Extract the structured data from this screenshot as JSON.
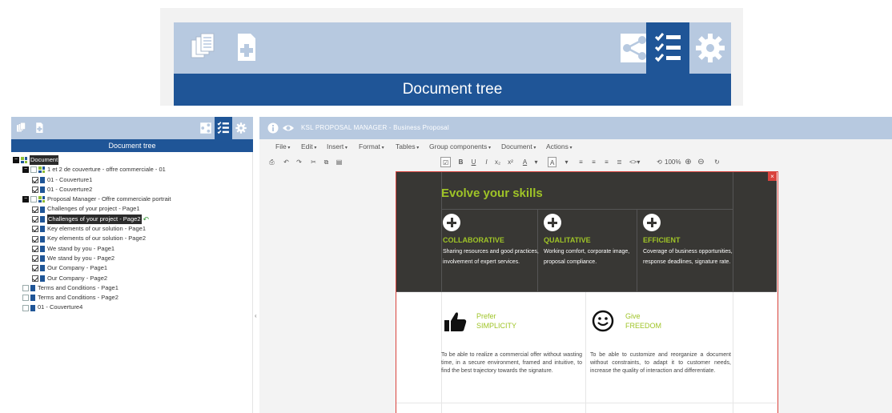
{
  "zoom": {
    "title": "Document tree"
  },
  "left_panel": {
    "title": "Document tree",
    "tree": [
      {
        "level": 0,
        "expander": "minus",
        "icon": "grid",
        "label": "Document",
        "selected": true,
        "checkbox": "none"
      },
      {
        "level": 1,
        "expander": "minus",
        "icon": "grid",
        "label": "1 et 2 de couverture - offre commerciale - 01",
        "checkbox": "empty"
      },
      {
        "level": 2,
        "icon": "doc",
        "label": "01 - Couverture1",
        "checkbox": "checked"
      },
      {
        "level": 2,
        "icon": "doc",
        "label": "01 - Couverture2",
        "checkbox": "checked"
      },
      {
        "level": 1,
        "expander": "minus",
        "icon": "grid",
        "label": "Proposal Manager - Offre commerciale portrait",
        "checkbox": "empty"
      },
      {
        "level": 2,
        "icon": "doc",
        "label": "Challenges of your project - Page1",
        "checkbox": "checked"
      },
      {
        "level": 2,
        "icon": "doc",
        "label": "Challenges of your project - Page2",
        "checkbox": "checked",
        "selected": true,
        "arrow": true
      },
      {
        "level": 2,
        "icon": "doc",
        "label": "Key elements of our solution - Page1",
        "checkbox": "checked"
      },
      {
        "level": 2,
        "icon": "doc",
        "label": "Key elements of our solution - Page2",
        "checkbox": "checked"
      },
      {
        "level": 2,
        "icon": "doc",
        "label": "We stand by you - Page1",
        "checkbox": "checked"
      },
      {
        "level": 2,
        "icon": "doc",
        "label": "We stand by you - Page2",
        "checkbox": "checked"
      },
      {
        "level": 2,
        "icon": "doc",
        "label": "Our Company - Page1",
        "checkbox": "checked"
      },
      {
        "level": 2,
        "icon": "doc",
        "label": "Our Company - Page2",
        "checkbox": "checked"
      },
      {
        "level": 1,
        "icon": "doc",
        "label": "Terms and Conditions - Page1",
        "checkbox": "empty"
      },
      {
        "level": 1,
        "icon": "doc",
        "label": "Terms and Conditions - Page2",
        "checkbox": "empty"
      },
      {
        "level": 1,
        "icon": "doc",
        "label": "01 - Couverture4",
        "checkbox": "empty"
      }
    ]
  },
  "editor": {
    "app_title": "KSL PROPOSAL MANAGER - Business Proposal",
    "menu": [
      "File",
      "Edit",
      "Insert",
      "Format",
      "Tables",
      "Group components",
      "Document",
      "Actions"
    ],
    "format_bar": {
      "bold": "B",
      "italic": "I",
      "underline": "U",
      "font_color": "A",
      "background_color": "A",
      "zoom_value": "100%"
    }
  },
  "page": {
    "close": "×",
    "hero_title": "Evolve your skills",
    "features": [
      {
        "title": "COLLABORATIVE",
        "desc": "Sharing resources and good practices, involvement of expert services."
      },
      {
        "title": "QUALITATIVE",
        "desc": "Working comfort, corporate image, proposal compliance."
      },
      {
        "title": "EFFICIENT",
        "desc": "Coverage of business opportunities, response deadlines, signature rate."
      }
    ],
    "blocks": [
      {
        "line1": "Prefer",
        "line2": "SIMPLICITY",
        "text": "To be able to realize a commercial offer without wasting time, in a secure environment, framed and intuitive, to find the best trajectory towards the signature."
      },
      {
        "line1": "Give",
        "line2": "FREEDOM",
        "text": "To be able to customize and reorganize a document without constraints, to adapt it to customer needs, increase the quality of interaction and differentiate."
      }
    ]
  },
  "colors": {
    "toolbar": "#b7c9e0",
    "header_blue": "#1f5597",
    "accent_green": "#9fc427",
    "hero_dark": "#383734",
    "frame_red": "#d9433d"
  }
}
